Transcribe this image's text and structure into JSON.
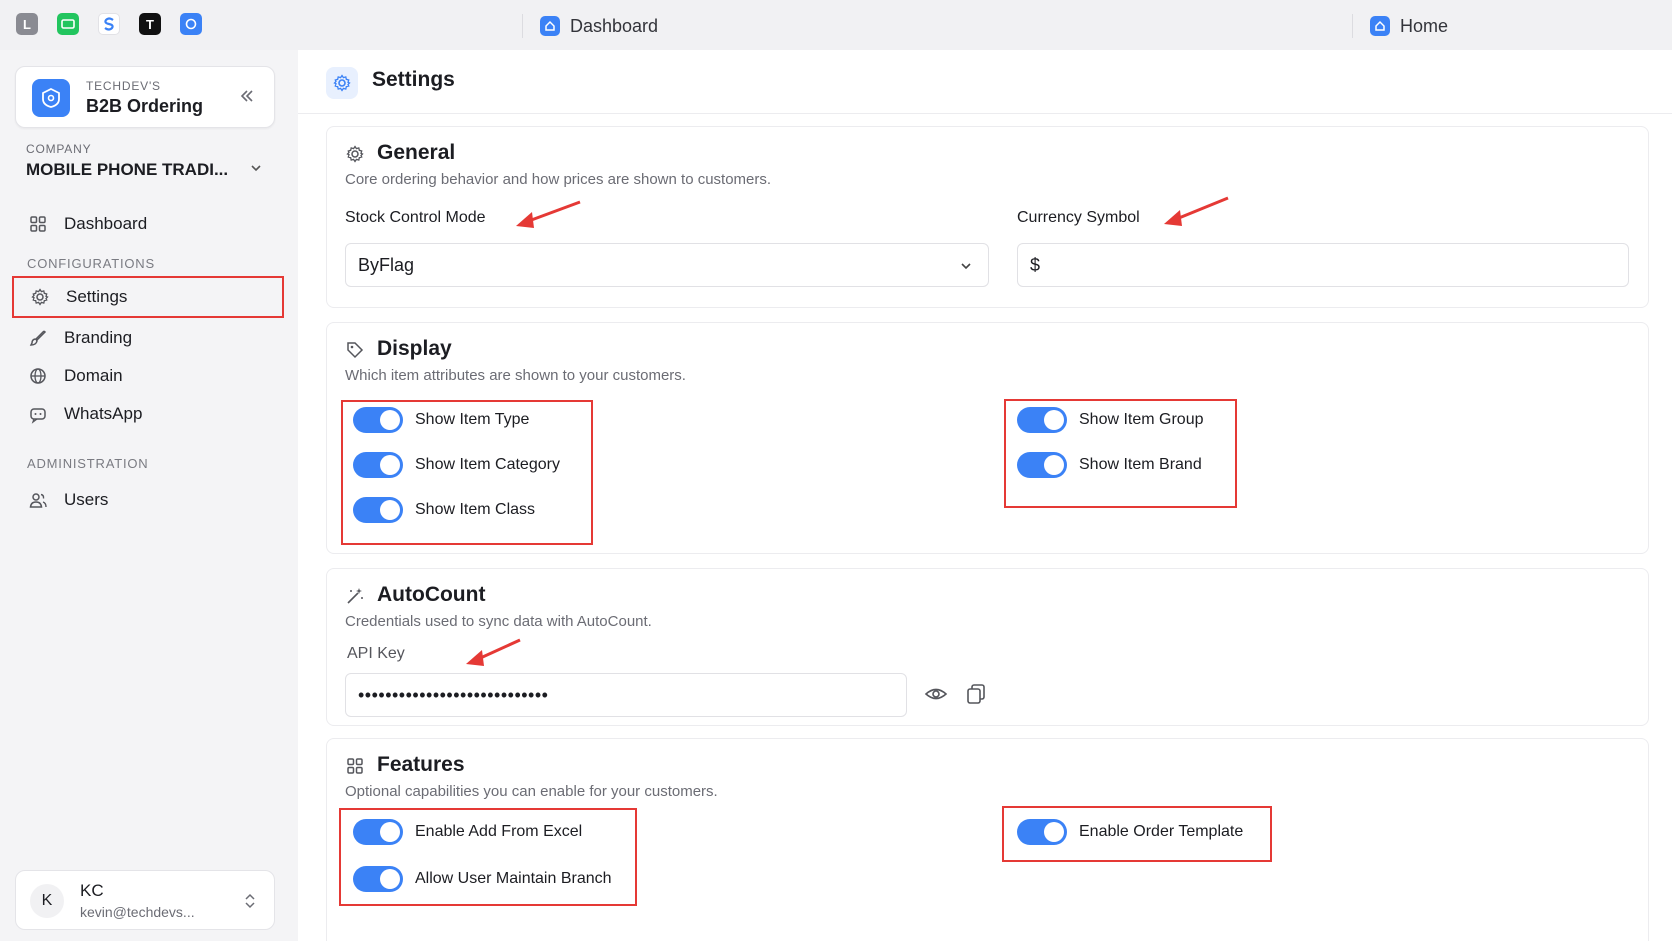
{
  "topbar": {
    "apps": [
      {
        "name": "app-l",
        "glyph": "L",
        "color": "#6b6c74"
      },
      {
        "name": "app-green",
        "glyph": "",
        "color": "#22c55e"
      },
      {
        "name": "app-s",
        "glyph": "",
        "color": "#ffffff"
      },
      {
        "name": "app-t",
        "glyph": "T",
        "color": "#111111"
      },
      {
        "name": "app-blue",
        "glyph": "",
        "color": "#3b82f6"
      }
    ],
    "tabs": [
      {
        "label": "Dashboard",
        "icon": "home-icon"
      },
      {
        "label": "Home",
        "icon": "home-icon"
      }
    ]
  },
  "sidebar": {
    "brand_sub": "TECHDEV'S",
    "brand_name": "B2B Ordering",
    "company_label": "COMPANY",
    "company_value": "MOBILE PHONE TRADI...",
    "dashboard": "Dashboard",
    "section_config": "CONFIGURATIONS",
    "items": [
      "Settings",
      "Branding",
      "Domain",
      "WhatsApp"
    ],
    "section_admin": "ADMINISTRATION",
    "users": "Users",
    "user": {
      "initial": "K",
      "name": "KC",
      "email": "kevin@techdevs..."
    }
  },
  "page": {
    "title": "Settings",
    "general": {
      "title": "General",
      "description": "Core ordering behavior and how prices are shown to customers.",
      "stock_label": "Stock Control Mode",
      "stock_value": "ByFlag",
      "currency_label": "Currency Symbol",
      "currency_value": "$"
    },
    "display": {
      "title": "Display",
      "description": "Which item attributes are shown to your customers.",
      "left": [
        "Show Item Type",
        "Show Item Category",
        "Show Item Class"
      ],
      "right": [
        "Show Item Group",
        "Show Item Brand"
      ]
    },
    "autocount": {
      "title": "AutoCount",
      "description": "Credentials used to sync data with AutoCount.",
      "api_label": "API Key",
      "api_value": "••••••••••••••••••••••••••••"
    },
    "features": {
      "title": "Features",
      "description": "Optional capabilities you can enable for your customers.",
      "left": [
        "Enable Add From Excel",
        "Allow User Maintain Branch"
      ],
      "right": [
        "Enable Order Template"
      ]
    }
  },
  "colors": {
    "accent": "#3b82f6",
    "annotation": "#e53935"
  }
}
